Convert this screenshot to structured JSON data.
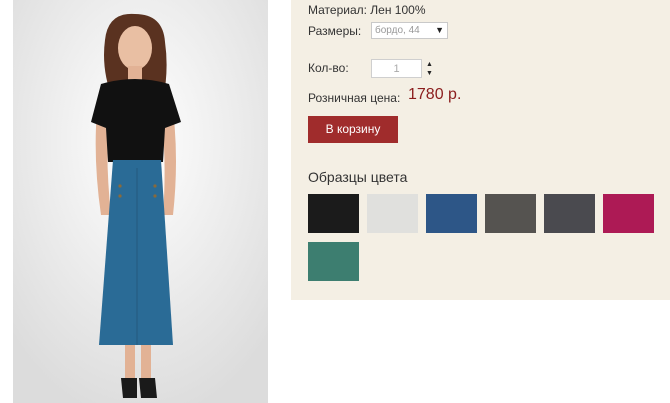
{
  "product": {
    "material": "Материал: Лен 100%",
    "sizes_label": "Размеры:",
    "size_selected": "бордо, 44",
    "qty_label": "Кол-во:",
    "qty_value": "1",
    "price_label": "Розничная цена:",
    "price_value": "1780 р.",
    "cart_button": "В корзину"
  },
  "swatches": {
    "title": "Образцы цвета",
    "colors": [
      "#1b1b1b",
      "#e0e0dd",
      "#2d5687",
      "#555350",
      "#4a4a4f",
      "#ad1a55",
      "#3d7e70"
    ]
  },
  "colors": {
    "panel_bg": "#f4efe4",
    "button_bg": "#a02c2c",
    "price_color": "#8b1d1d"
  }
}
